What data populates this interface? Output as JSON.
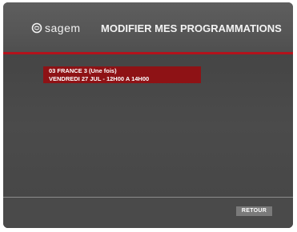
{
  "header": {
    "brand": "sagem",
    "title": "MODIFIER MES PROGRAMMATIONS"
  },
  "programs": [
    {
      "line1": "03 FRANCE 3 (Une fois)",
      "line2": "VENDREDI 27 JUL - 12H00 A 14H00"
    }
  ],
  "footer": {
    "back_label": "RETOUR"
  },
  "colors": {
    "accent": "#b3121c",
    "selected_item": "#8e1215",
    "background": "#4a4a4a",
    "button": "#7a7a7a"
  },
  "icons": {
    "logo": "sagem-logo-icon"
  }
}
